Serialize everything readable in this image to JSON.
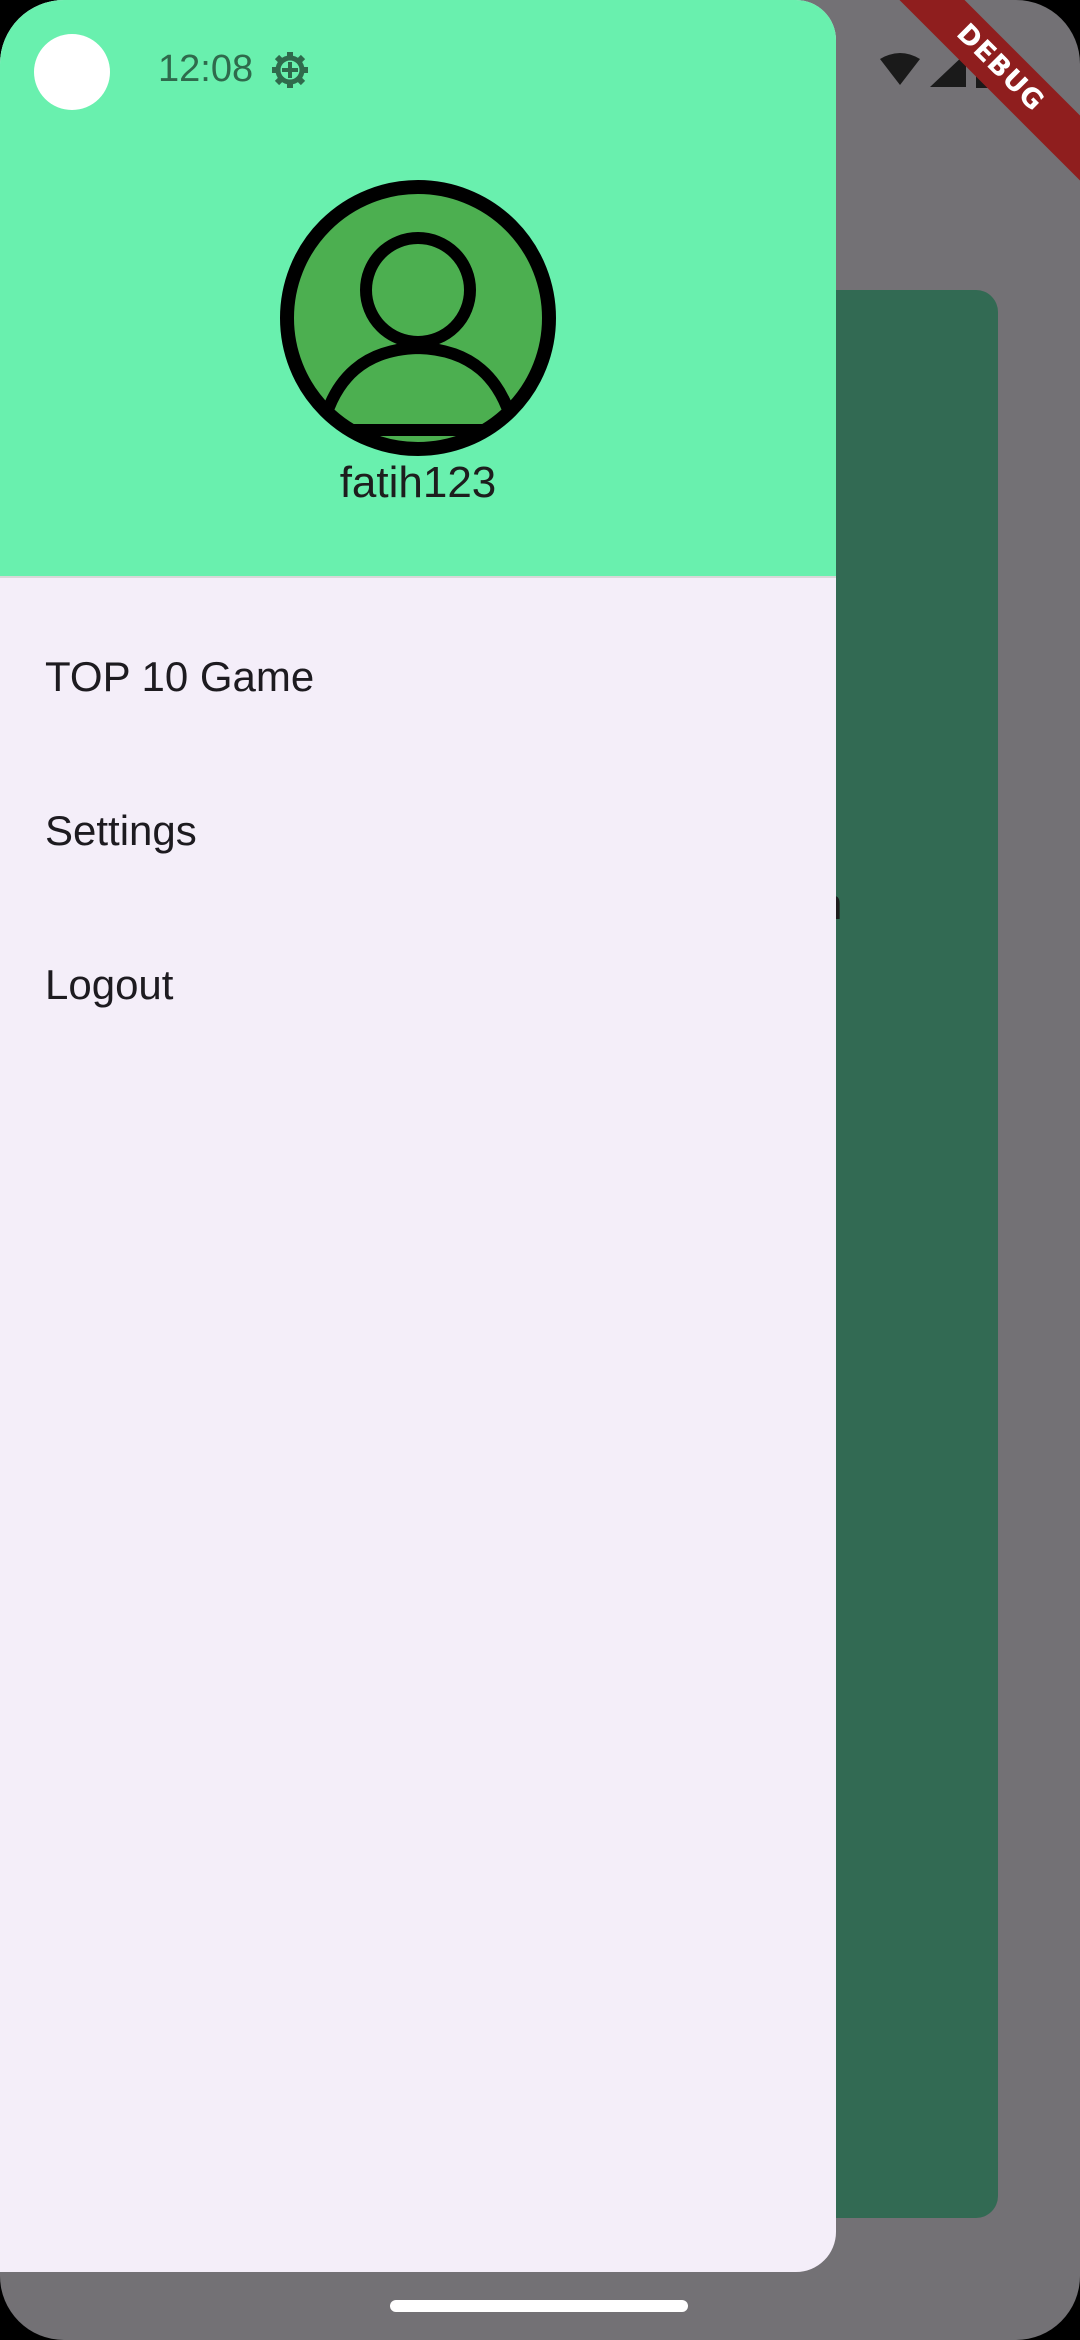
{
  "status_bar": {
    "time": "12:08",
    "icons": [
      "gear-icon",
      "wifi-icon",
      "cellular-icon",
      "battery-icon"
    ]
  },
  "background": {
    "partial_text": "n",
    "debug_banner": "DEBUG"
  },
  "drawer": {
    "header": {
      "avatar_icon": "account-circle-icon",
      "username": "fatih123"
    },
    "items": [
      {
        "label": "TOP 10 Game"
      },
      {
        "label": "Settings"
      },
      {
        "label": "Logout"
      }
    ]
  },
  "colors": {
    "header_bg": "#69f0ae",
    "drawer_bg": "#f4eef9",
    "scrim": "#737175",
    "bg_card": "#326a53",
    "avatar_fill": "#4caf50",
    "debug_banner": "#8f1e1e"
  }
}
